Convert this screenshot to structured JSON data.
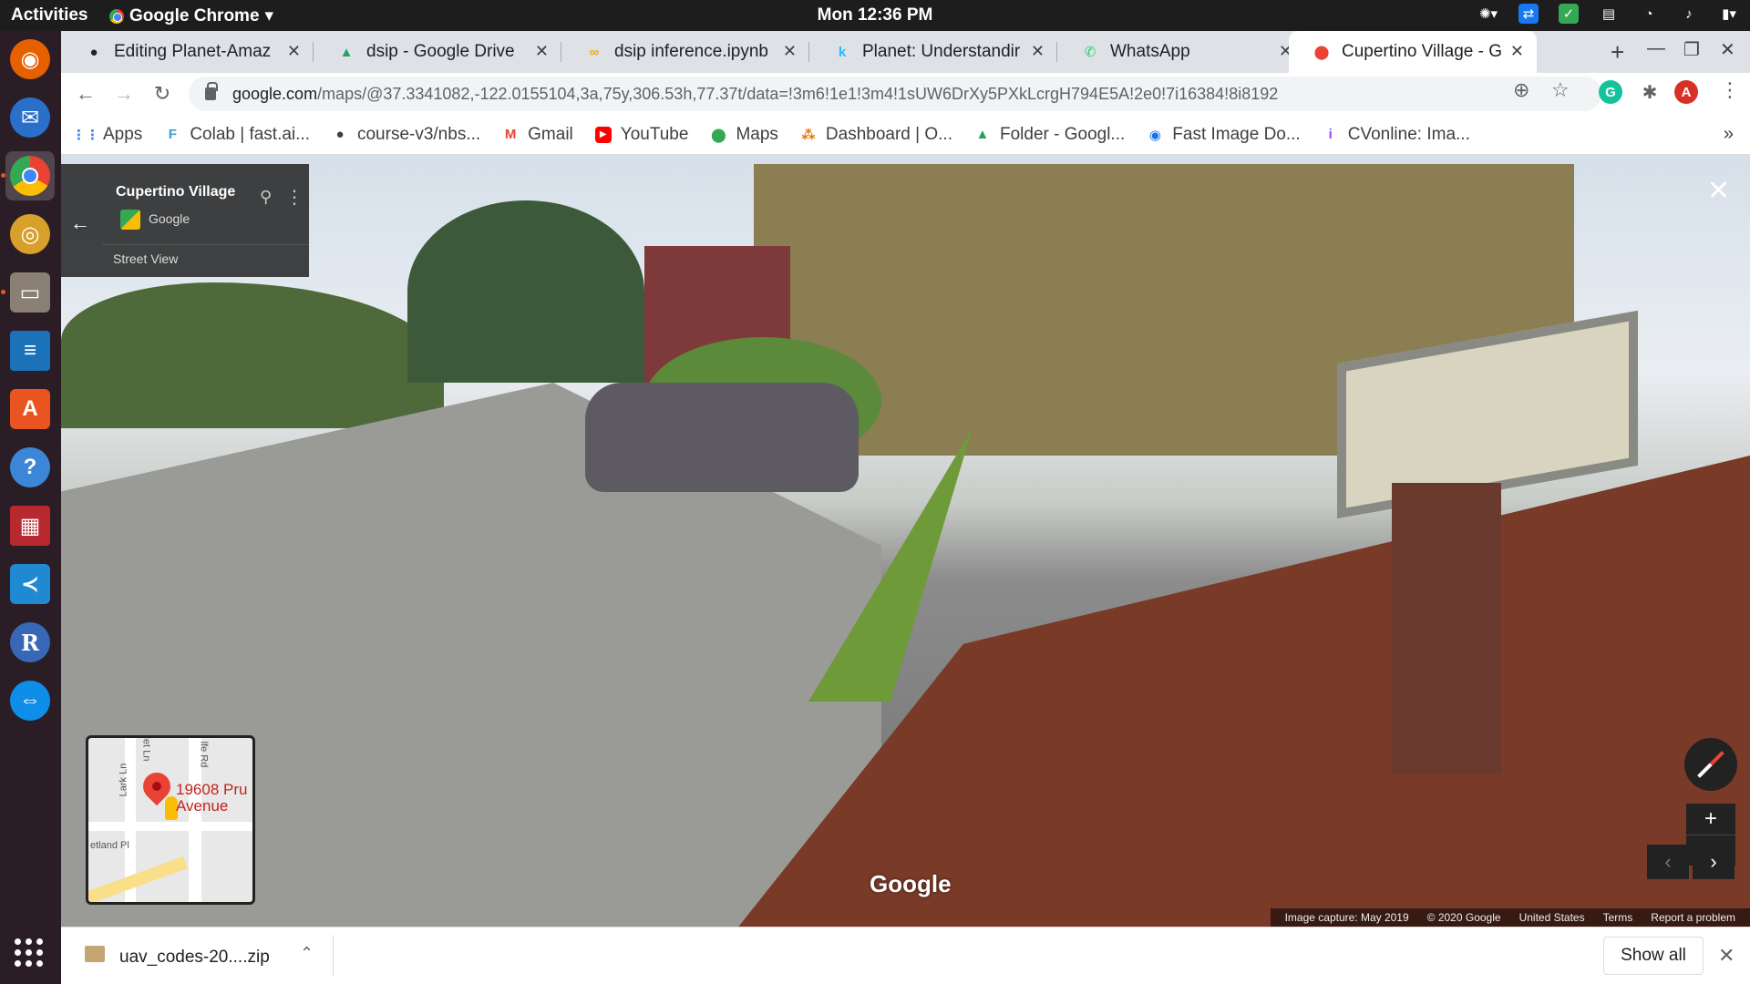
{
  "topbar": {
    "activities": "Activities",
    "app_name": "Google Chrome",
    "clock": "Mon 12:36 PM"
  },
  "tabs": [
    {
      "title": "Editing Planet-Amaz",
      "icon": "github-icon"
    },
    {
      "title": "dsip - Google Drive",
      "icon": "google-drive-icon"
    },
    {
      "title": "dsip inference.ipynb",
      "icon": "colab-icon"
    },
    {
      "title": "Planet: Understandir",
      "icon": "kaggle-icon"
    },
    {
      "title": "WhatsApp",
      "icon": "whatsapp-icon"
    },
    {
      "title": "Cupertino Village - G",
      "icon": "google-maps-icon",
      "active": true
    }
  ],
  "toolbar": {
    "url_host": "google.com",
    "url_path": "/maps/@37.3341082,-122.0155104,3a,75y,306.53h,77.37t/data=!3m6!1e1!3m4!1sUW6DrXy5PXkLcrgH794E5A!2e0!7i16384!8i8192",
    "profile_initial": "A"
  },
  "bookmarks": [
    {
      "label": "Apps",
      "icon": "apps-grid-icon"
    },
    {
      "label": "Colab | fast.ai...",
      "icon": "fastai-icon"
    },
    {
      "label": "course-v3/nbs...",
      "icon": "github-icon"
    },
    {
      "label": "Gmail",
      "icon": "gmail-icon"
    },
    {
      "label": "YouTube",
      "icon": "youtube-icon"
    },
    {
      "label": "Maps",
      "icon": "google-maps-icon"
    },
    {
      "label": "Dashboard | O...",
      "icon": "dashboard-icon"
    },
    {
      "label": "Folder - Googl...",
      "icon": "google-drive-icon"
    },
    {
      "label": "Fast Image Do...",
      "icon": "chrome-extension-icon"
    },
    {
      "label": "CVonline: Ima...",
      "icon": "cvonline-icon"
    }
  ],
  "streetview": {
    "place_name": "Cupertino Village",
    "provider": "Google",
    "mode": "Street View",
    "minimap_address": "19608 Pru\nAvenue",
    "minimap_streets": [
      "Lark Ln",
      "lfe Rd",
      "etland Pl",
      "let Ln"
    ],
    "watermark": "Google",
    "attribution": [
      "Image capture: May 2019",
      "© 2020 Google",
      "United States",
      "Terms",
      "Report a problem"
    ]
  },
  "download_shelf": {
    "file_name": "uav_codes-20....zip",
    "show_all_label": "Show all"
  },
  "dock": [
    {
      "name": "firefox-icon",
      "color": "#e66000"
    },
    {
      "name": "thunderbird-icon",
      "color": "#2a6fc9"
    },
    {
      "name": "chrome-icon",
      "color": "#4285f4"
    },
    {
      "name": "rhythmbox-icon",
      "color": "#d8a02a"
    },
    {
      "name": "files-icon",
      "color": "#8a7f74"
    },
    {
      "name": "libreoffice-writer-icon",
      "color": "#1c72b8"
    },
    {
      "name": "software-center-icon",
      "color": "#e95420"
    },
    {
      "name": "help-icon",
      "color": "#3b86d6"
    },
    {
      "name": "terminal-red-icon",
      "color": "#b8292f"
    },
    {
      "name": "vscode-icon",
      "color": "#1f8ad2"
    },
    {
      "name": "r-icon",
      "color": "#3668b7"
    },
    {
      "name": "teamviewer-icon",
      "color": "#0e8ee9"
    }
  ],
  "colors": {
    "accent_chrome_blue": "#1a73e8",
    "ubuntu_orange": "#e95420",
    "maps_red": "#ea4335"
  }
}
